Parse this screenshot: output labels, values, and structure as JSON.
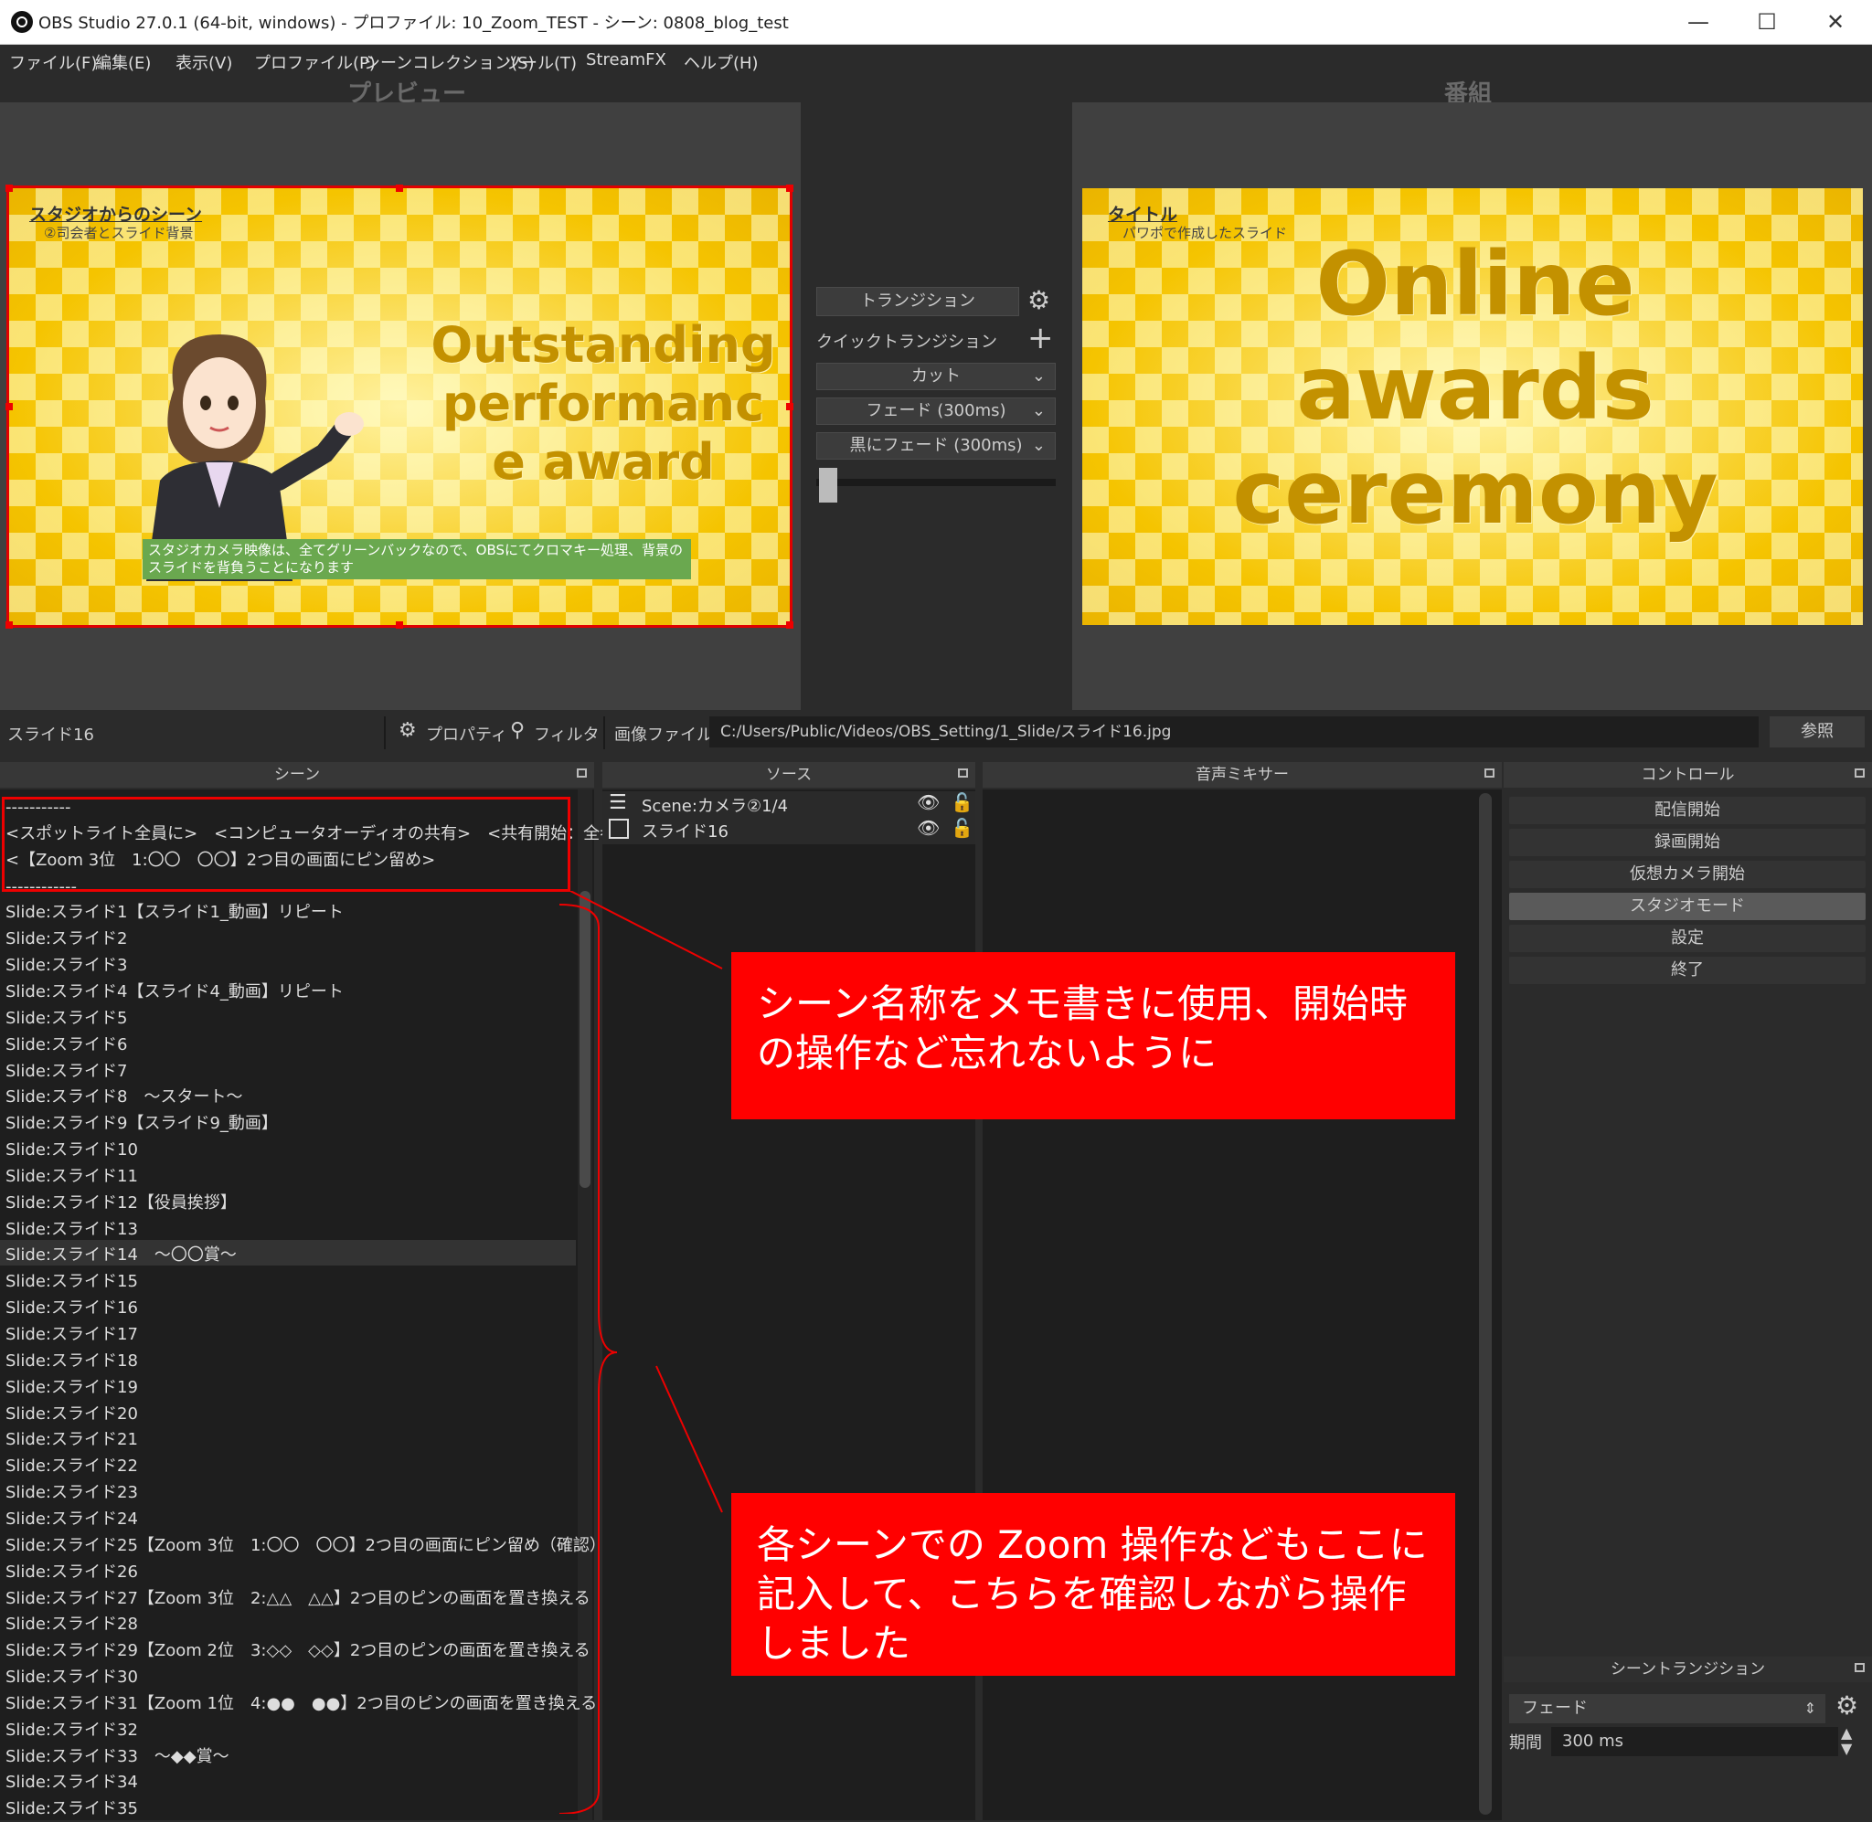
{
  "window": {
    "title": "OBS Studio 27.0.1 (64-bit, windows) - プロファイル: 10_Zoom_TEST - シーン: 0808_blog_test",
    "minimize": "—",
    "maximize": "☐",
    "close": "✕"
  },
  "menu": [
    "ファイル(F)",
    "編集(E)",
    "表示(V)",
    "プロファイル(P)",
    "シーンコレクション(S)",
    "ツール(T)",
    "StreamFX",
    "ヘルプ(H)"
  ],
  "preview": {
    "label": "プレビュー",
    "heading": "スタジオからのシーン",
    "sub": "②司会者とスライド背景",
    "lines": [
      "Outstanding",
      "performanc",
      "e award"
    ],
    "note": "スタジオカメラ映像は、全てグリーンバックなので、OBSにてクロマキー処理、背景のスライドを背負うことになります",
    "colors": {
      "selection": "#e00000",
      "note_bg": "#6aa84f"
    }
  },
  "program": {
    "label": "番組",
    "heading": "タイトル",
    "sub": "パワポで作成したスライド",
    "lines": [
      "Online",
      "awards",
      "ceremony"
    ]
  },
  "transitions": {
    "button": "トランジション",
    "quick_label": "クイックトランジション",
    "items": [
      "カット",
      "フェード (300ms)",
      "黒にフェード (300ms)"
    ]
  },
  "source_bar": {
    "selected": "スライド16",
    "properties": "プロパティ",
    "filters": "フィルタ",
    "file_label": "画像ファイル",
    "file_path": "C:/Users/Public/Videos/OBS_Setting/1_Slide/スライド16.jpg",
    "browse": "参照"
  },
  "docks": {
    "scenes": "シーン",
    "sources": "ソース",
    "mixer": "音声ミキサー",
    "controls": "コントロール",
    "scene_transitions": "シーントランジション"
  },
  "scenes": [
    "-----------",
    "<スポットライト全員に>　<コンピュータオーディオの共有>　<共有開始：全参加者>",
    "<【Zoom 3位　1:〇〇　〇〇】2つ目の画面にピン留め>",
    "------------",
    "Slide:スライド1【スライド1_動画】リピート",
    "Slide:スライド2",
    "Slide:スライド3",
    "Slide:スライド4【スライド4_動画】リピート",
    "Slide:スライド5",
    "Slide:スライド6",
    "Slide:スライド7",
    "Slide:スライド8　～スタート～",
    "Slide:スライド9【スライド9_動画】",
    "Slide:スライド10",
    "Slide:スライド11",
    "Slide:スライド12【役員挨拶】",
    "Slide:スライド13",
    "Slide:スライド14　～〇〇賞～",
    "Slide:スライド15",
    "Slide:スライド16",
    "Slide:スライド17",
    "Slide:スライド18",
    "Slide:スライド19",
    "Slide:スライド20",
    "Slide:スライド21",
    "Slide:スライド22",
    "Slide:スライド23",
    "Slide:スライド24",
    "Slide:スライド25【Zoom 3位　1:〇〇　〇〇】2つ目の画面にピン留め（確認）",
    "Slide:スライド26",
    "Slide:スライド27【Zoom 3位　2:△△　△△】2つ目のピンの画面を置き換える",
    "Slide:スライド28",
    "Slide:スライド29【Zoom 2位　3:◇◇　◇◇】2つ目のピンの画面を置き換える",
    "Slide:スライド30",
    "Slide:スライド31【Zoom 1位　4:●●　●●】2つ目のピンの画面を置き換える",
    "Slide:スライド32",
    "Slide:スライド33　～◆◆賞～",
    "Slide:スライド34",
    "Slide:スライド35"
  ],
  "sources": [
    {
      "name": "Scene:カメラ②1/4",
      "icon": "scene-list-icon"
    },
    {
      "name": "スライド16",
      "icon": "image-icon"
    }
  ],
  "controls": [
    "配信開始",
    "録画開始",
    "仮想カメラ開始",
    "スタジオモード",
    "設定",
    "終了"
  ],
  "scene_transition": {
    "value": "フェード",
    "duration_label": "期間",
    "duration_value": "300 ms"
  },
  "callouts": [
    "シーン名称をメモ書きに使用、開始時の操作など忘れないように",
    "各シーンでの Zoom 操作などもここに記入して、こちらを確認しながら操作しました"
  ]
}
